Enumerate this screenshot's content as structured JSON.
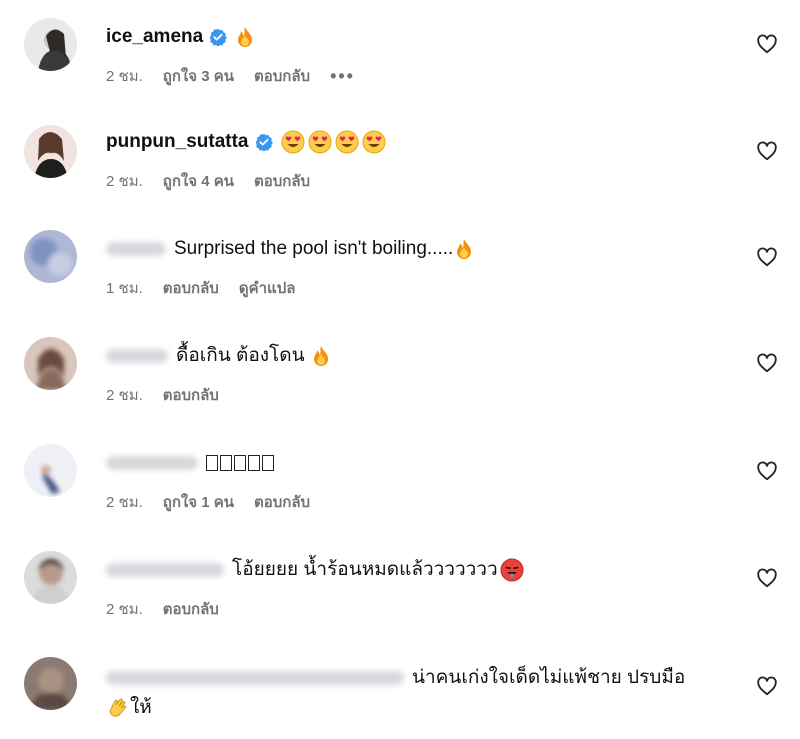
{
  "comments": [
    {
      "username": "ice_amena",
      "verified": true,
      "text": "",
      "emojis": [
        "fire"
      ],
      "time": "2 ชม.",
      "likes": "ถูกใจ 3 คน",
      "reply": "ตอบกลับ",
      "more": "•••"
    },
    {
      "username": "punpun_sutatta",
      "verified": true,
      "text": "",
      "emojis": [
        "heart-eyes",
        "heart-eyes",
        "heart-eyes",
        "heart-eyes"
      ],
      "time": "2 ชม.",
      "likes": "ถูกใจ 4 คน",
      "reply": "ตอบกลับ"
    },
    {
      "username": "",
      "verified": false,
      "text": "Surprised the pool isn't boiling.....",
      "emojis": [
        "fire"
      ],
      "time": "1 ชม.",
      "reply": "ตอบกลับ",
      "translate": "ดูคำแปล"
    },
    {
      "username": "",
      "verified": false,
      "text": "ดื้อเกิน ต้องโดน",
      "emojis": [
        "fire"
      ],
      "time": "2 ชม.",
      "reply": "ตอบกลับ"
    },
    {
      "username": "",
      "verified": false,
      "text": "",
      "tofu_count": 5,
      "emojis": [],
      "time": "2 ชม.",
      "likes": "ถูกใจ 1 คน",
      "reply": "ตอบกลับ"
    },
    {
      "username": "",
      "verified": false,
      "text": "โอ้ยยยย น้ำร้อนหมดแล้ววววววว",
      "emojis": [
        "hot-face"
      ],
      "time": "2 ชม.",
      "reply": "ตอบกลับ"
    },
    {
      "username": "",
      "verified": false,
      "text": "น่าคนเก่งใจเด็ดไม่แพ้ชาย ปรบมือ",
      "text2": "ให้",
      "emojis": [
        "clapping-hands"
      ],
      "time": "",
      "reply": ""
    }
  ],
  "colors": {
    "verified": "#3897f0",
    "meta": "#737373",
    "text": "#111111",
    "heart_stroke": "#262626"
  },
  "icons": {
    "like": "heart-outline-icon",
    "verified": "verified-badge-icon",
    "more": "more-options-icon"
  }
}
